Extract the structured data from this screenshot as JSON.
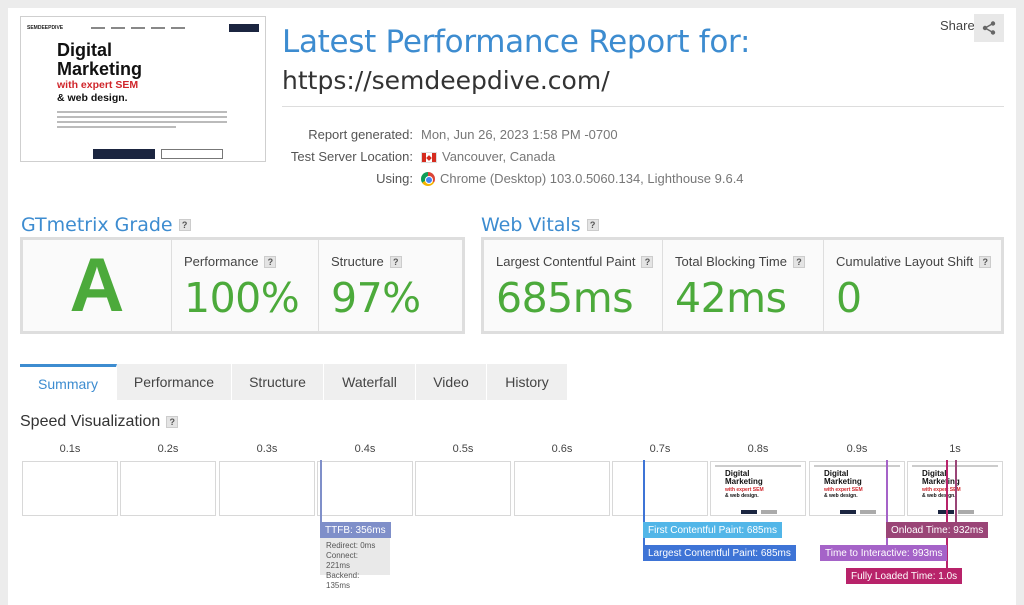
{
  "header": {
    "title": "Latest Performance Report for:",
    "url": "https://semdeepdive.com/",
    "share_label": "Share"
  },
  "thumbnail": {
    "logo": "SEMDEEPDIVE",
    "headline": "Digital Marketing",
    "subline": "with expert SEM",
    "subline2": "& web design."
  },
  "report": {
    "labels": [
      "Report generated:",
      "Test Server Location:",
      "Using:"
    ],
    "generated": "Mon, Jun 26, 2023 1:58 PM -0700",
    "location": "Vancouver, Canada",
    "using": "Chrome (Desktop) 103.0.5060.134, Lighthouse 9.6.4"
  },
  "grade": {
    "section_title": "GTmetrix Grade",
    "letter": "A",
    "performance_label": "Performance",
    "performance_value": "100%",
    "structure_label": "Structure",
    "structure_value": "97%"
  },
  "vitals": {
    "section_title": "Web Vitals",
    "lcp_label": "Largest Contentful Paint",
    "lcp_value": "685ms",
    "tbt_label": "Total Blocking Time",
    "tbt_value": "42ms",
    "cls_label": "Cumulative Layout Shift",
    "cls_value": "0"
  },
  "tabs": [
    "Summary",
    "Performance",
    "Structure",
    "Waterfall",
    "Video",
    "History"
  ],
  "active_tab": "Summary",
  "speed": {
    "title": "Speed Visualization",
    "ticks": [
      "0.1s",
      "0.2s",
      "0.3s",
      "0.4s",
      "0.5s",
      "0.6s",
      "0.7s",
      "0.8s",
      "0.9s",
      "1s"
    ],
    "markers": {
      "ttfb": "TTFB: 356ms",
      "fcp": "First Contentful Paint: 685ms",
      "lcp": "Largest Contentful Paint: 685ms",
      "onload": "Onload Time: 932ms",
      "tti": "Time to Interactive: 993ms",
      "fully_loaded": "Fully Loaded Time: 1.0s"
    },
    "ttfb_details": [
      "Redirect: 0ms",
      "Connect: 221ms",
      "Backend: 135ms"
    ]
  },
  "colors": {
    "accent": "#3d8cd0",
    "grade_green": "#4caa3b",
    "ttfb": "#7f8fc9",
    "fcp": "#52b6e8",
    "lcp": "#3e74d6",
    "onload": "#9a4577",
    "tti": "#a563c8",
    "fully_loaded": "#b8236a"
  }
}
